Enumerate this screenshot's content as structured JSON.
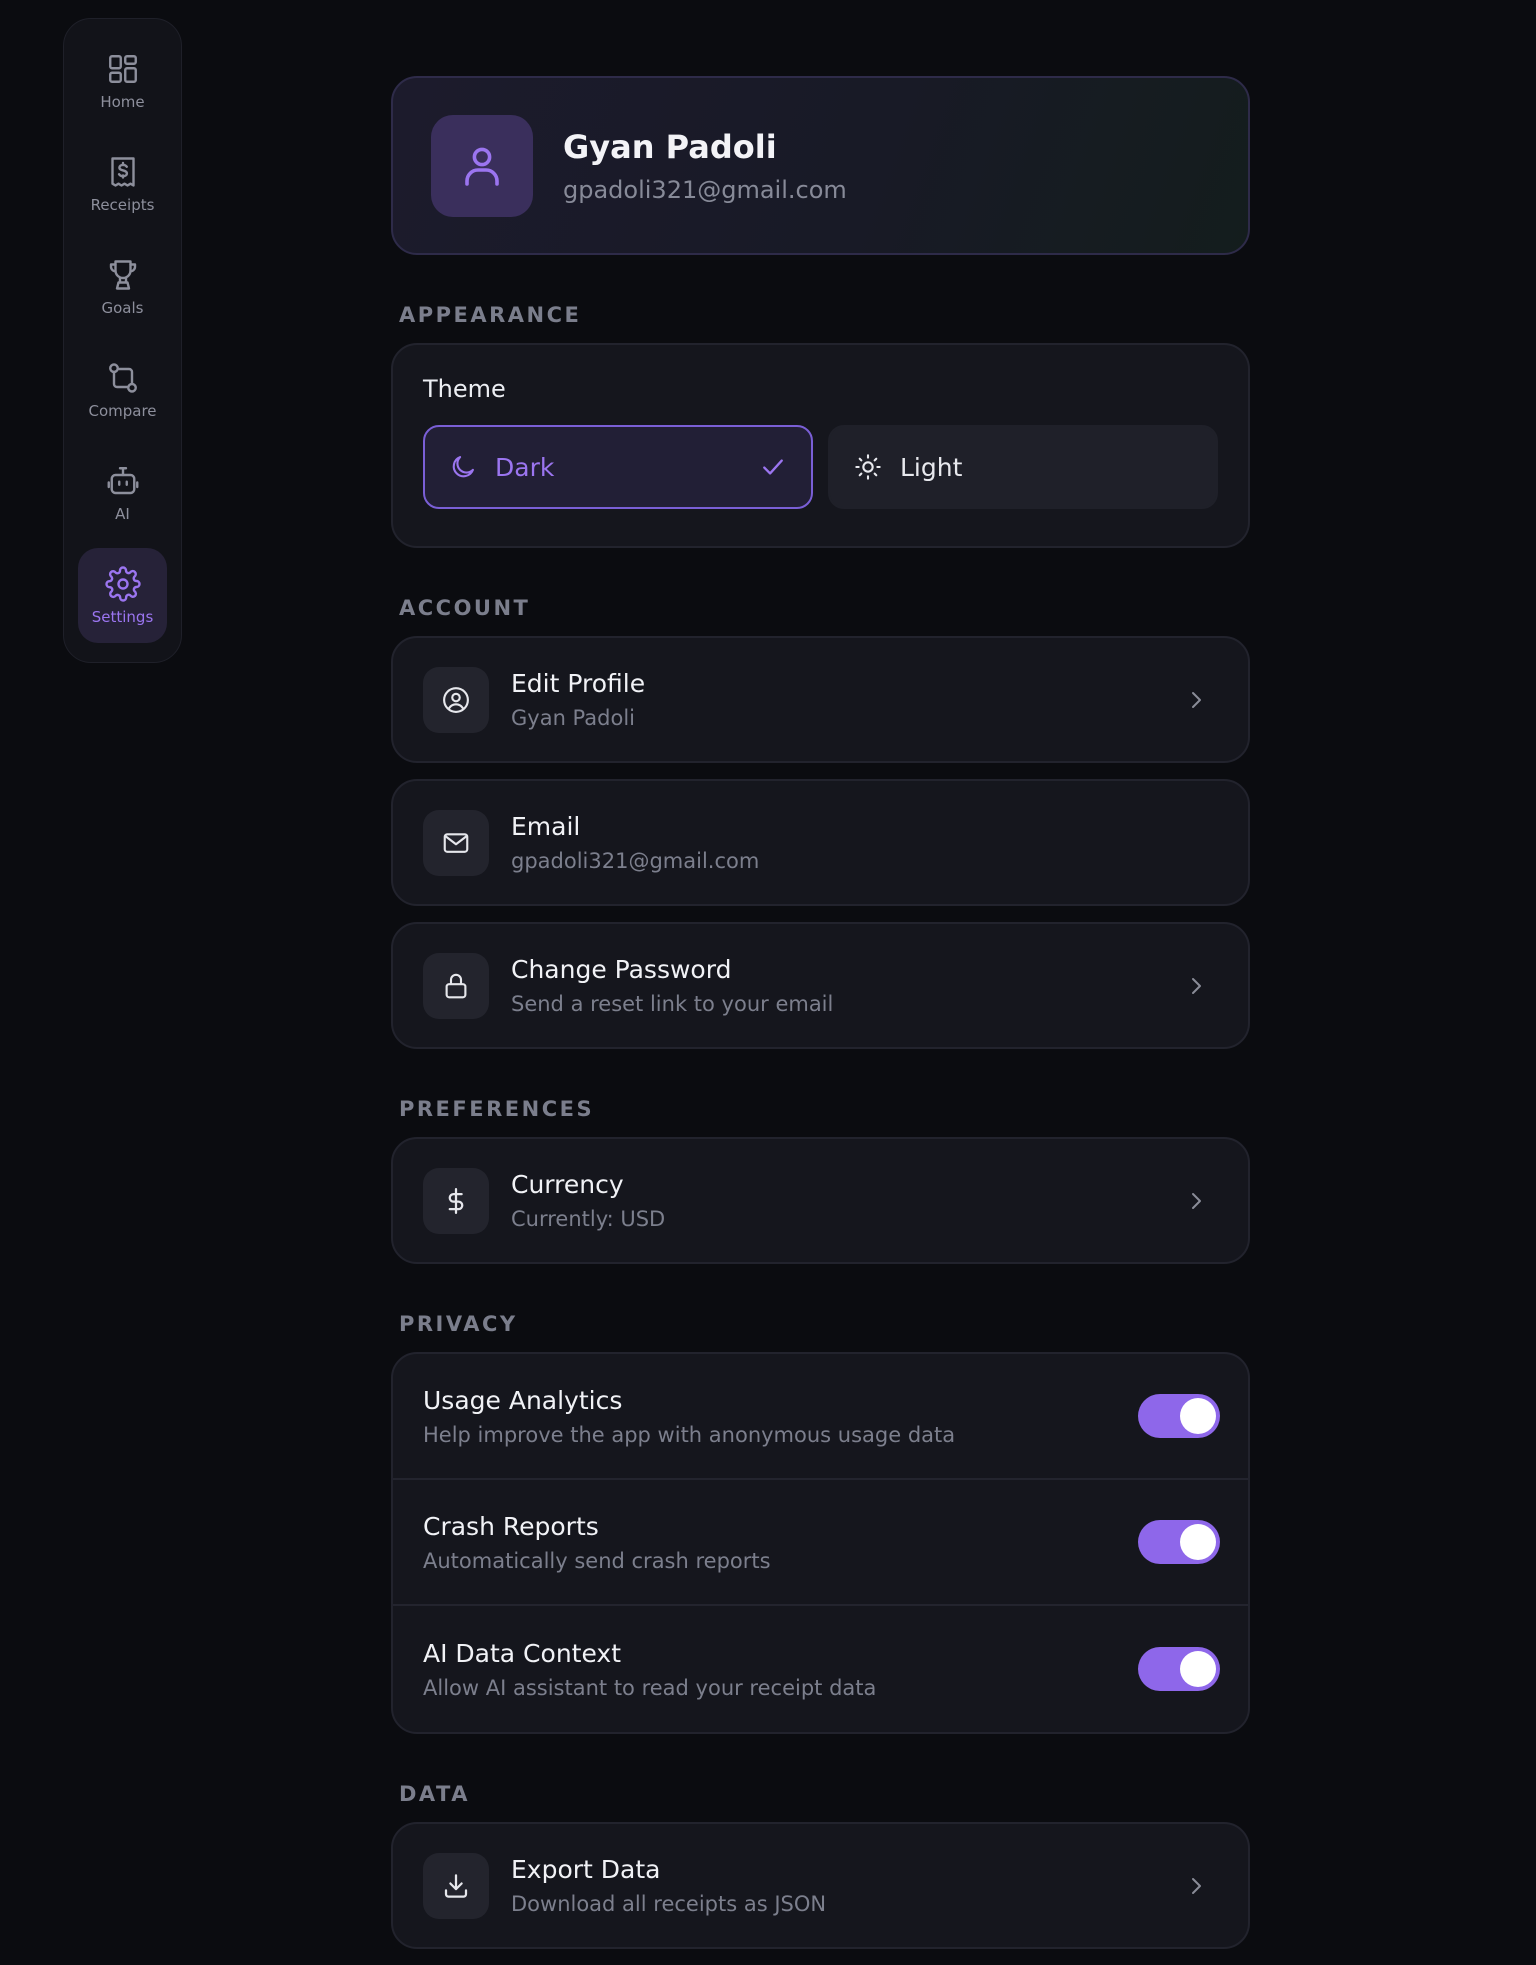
{
  "sidebar": {
    "items": [
      {
        "label": "Home",
        "icon": "home-grid-icon"
      },
      {
        "label": "Receipts",
        "icon": "receipt-icon"
      },
      {
        "label": "Goals",
        "icon": "trophy-icon"
      },
      {
        "label": "Compare",
        "icon": "compare-icon"
      },
      {
        "label": "AI",
        "icon": "robot-icon"
      },
      {
        "label": "Settings",
        "icon": "gear-icon",
        "active": true
      }
    ]
  },
  "profile": {
    "name": "Gyan Padoli",
    "email": "gpadoli321@gmail.com"
  },
  "appearance": {
    "section_title": "APPEARANCE",
    "theme_title": "Theme",
    "options": [
      {
        "label": "Dark",
        "selected": true
      },
      {
        "label": "Light",
        "selected": false
      }
    ]
  },
  "account": {
    "section_title": "ACCOUNT",
    "items": [
      {
        "title": "Edit Profile",
        "subtitle": "Gyan Padoli",
        "icon": "user-circle-icon"
      },
      {
        "title": "Email",
        "subtitle": "gpadoli321@gmail.com",
        "icon": "mail-icon"
      },
      {
        "title": "Change Password",
        "subtitle": "Send a reset link to your email",
        "icon": "lock-icon"
      }
    ]
  },
  "preferences": {
    "section_title": "PREFERENCES",
    "items": [
      {
        "title": "Currency",
        "subtitle": "Currently: USD",
        "icon": "dollar-icon"
      }
    ]
  },
  "privacy": {
    "section_title": "PRIVACY",
    "items": [
      {
        "title": "Usage Analytics",
        "subtitle": "Help improve the app with anonymous usage data",
        "enabled": true
      },
      {
        "title": "Crash Reports",
        "subtitle": "Automatically send crash reports",
        "enabled": true
      },
      {
        "title": "AI Data Context",
        "subtitle": "Allow AI assistant to read your receipt data",
        "enabled": true
      }
    ]
  },
  "data": {
    "section_title": "DATA",
    "items": [
      {
        "title": "Export Data",
        "subtitle": "Download all receipts as JSON",
        "icon": "download-icon"
      }
    ]
  },
  "colors": {
    "accent": "#9b75f0",
    "toggle_on": "#8e67ea",
    "background": "#0b0c10",
    "card": "#15161d"
  }
}
